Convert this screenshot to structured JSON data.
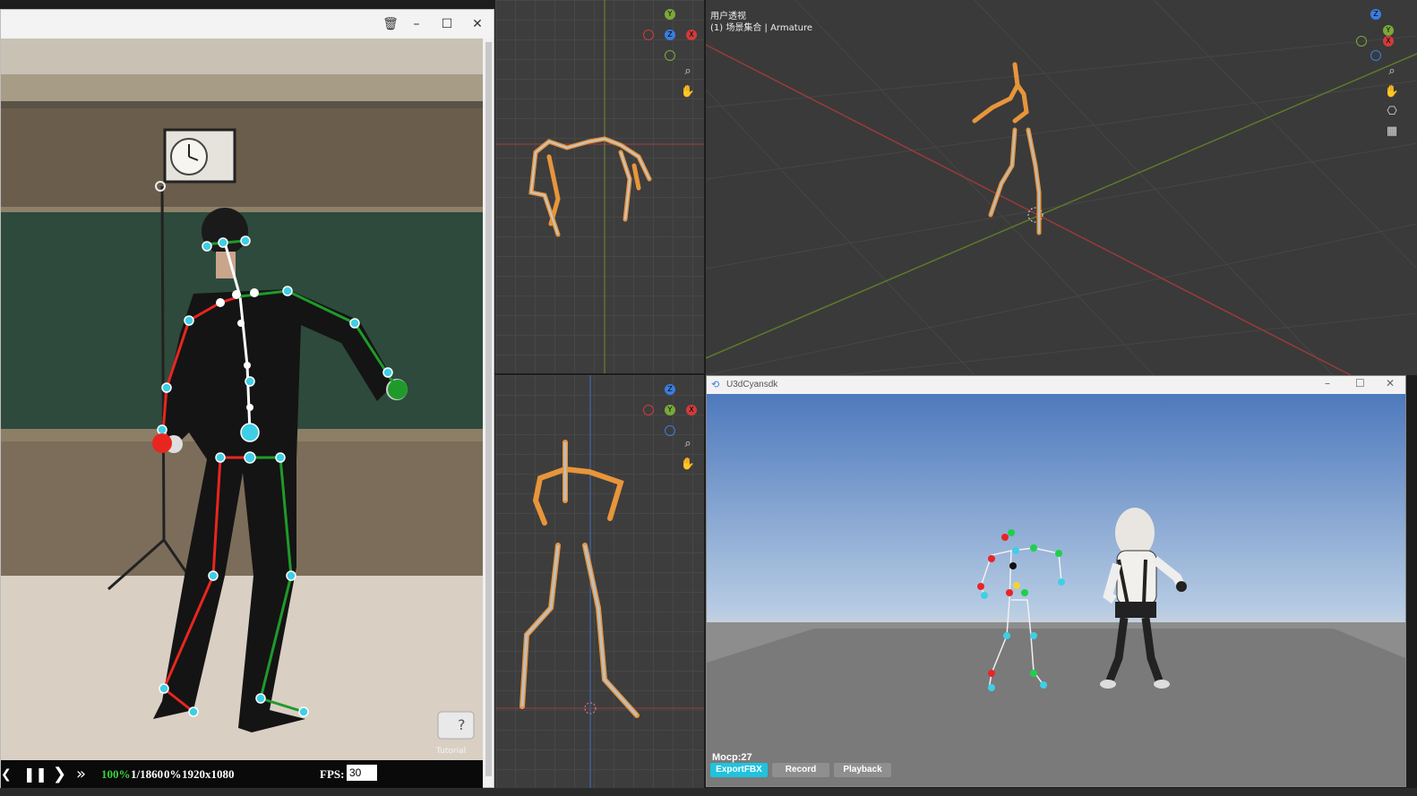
{
  "video_window": {
    "controls": {
      "progress": "100%",
      "frame": "1/1860",
      "percent": "0%",
      "resolution": "1920x1080",
      "fps_label": "FPS:",
      "fps_value": "30"
    },
    "tutorial_label": "Tutorial",
    "tutorial_symbol": "?"
  },
  "viewport_main": {
    "view_name": "用户透视",
    "collection": "(1) 场景集合 | Armature"
  },
  "gizmo_labels": {
    "x": "X",
    "y": "Y",
    "z": "Z"
  },
  "unity_window": {
    "title": "U3dCyansdk",
    "mocap_label": "Mocp:27",
    "export_button": "ExportFBX",
    "record_button": "Record",
    "playback_button": "Playback"
  },
  "colors": {
    "accent_cyan": "#1fc3de",
    "joint_cyan": "#3ecfe6",
    "bone_red": "#e8261f",
    "bone_green": "#1f9a2a",
    "armature_orange": "#e8953a",
    "viewport_bg": "#3d3d3d",
    "unity_sky": "#7fa4d6"
  },
  "icons": [
    "trash-icon",
    "minimize-icon",
    "maximize-icon",
    "close-icon",
    "pause-icon",
    "play-icon",
    "skip-icon",
    "zoom-icon",
    "hand-icon",
    "camera-icon",
    "grid-icon",
    "unity-logo-icon"
  ]
}
